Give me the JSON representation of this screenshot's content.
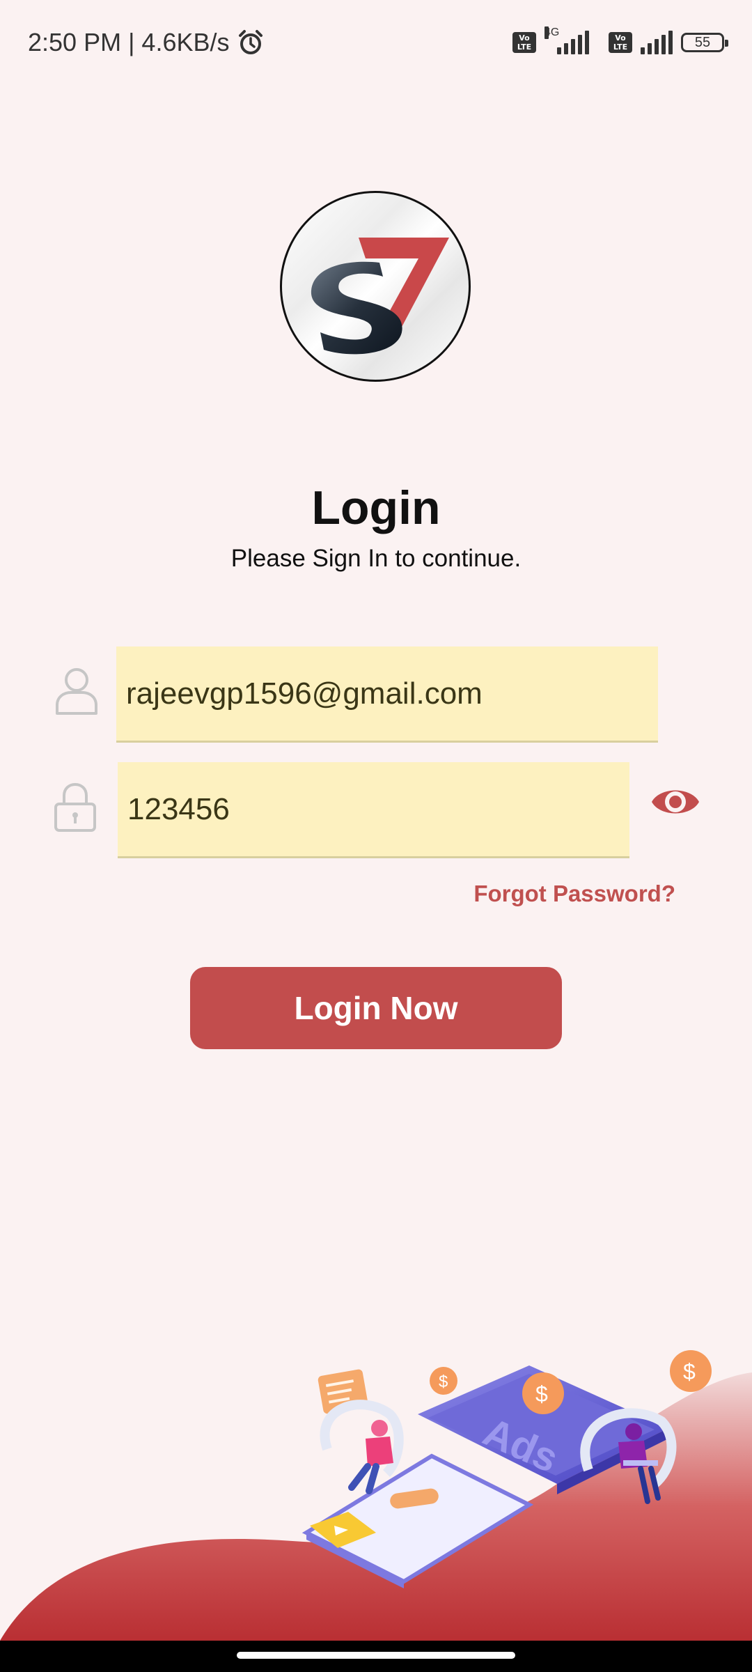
{
  "status_bar": {
    "time_speed": "2:50 PM | 4.6KB/s",
    "network_type": "4G",
    "volte_label": "Vo LTE",
    "battery": "55"
  },
  "login": {
    "title": "Login",
    "subtitle": "Please Sign In to continue.",
    "email_value": "rajeevgp1596@gmail.com",
    "password_value": "123456",
    "forgot_password": "Forgot Password?",
    "login_button": "Login Now"
  },
  "illustration": {
    "screen_text": "Ads"
  },
  "colors": {
    "accent": "#c24d4d",
    "field_bg": "#fdf1c0",
    "page_bg": "#fbf2f2"
  }
}
